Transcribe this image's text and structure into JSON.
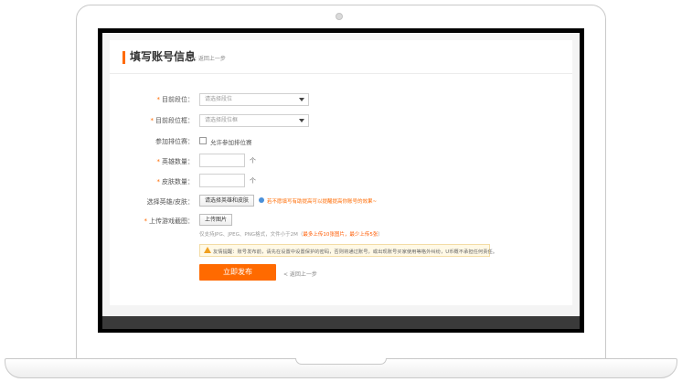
{
  "header": {
    "title": "填写账号信息",
    "back_link": "< 返回上一步"
  },
  "form": {
    "current_rank": {
      "label": "目前段位：",
      "placeholder": "请选择段位"
    },
    "current_tier": {
      "label": "目前段位框：",
      "placeholder": "请选择段位框"
    },
    "tournament": {
      "label": "参加排位赛：",
      "checkbox_label": "允许参加排位赛"
    },
    "hero_count": {
      "label": "英雄数量：",
      "unit": "个"
    },
    "skin_count": {
      "label": "皮肤数量：",
      "unit": "个"
    },
    "select_heroes": {
      "label": "选择英雄/皮肤：",
      "button": "请选择英雄和皮肤",
      "hint": "若不愿填写有助提高可以提醒提高你账号的效果~"
    },
    "screenshot": {
      "label": "上传游戏截图：",
      "button": "上传图片",
      "note_prefix": "仅支持JPG、JPEG、PNG格式，文件小于2M（",
      "note_highlight": "最多上传10张图片，最少上传5张",
      "note_suffix": "）"
    },
    "required_mark": "*"
  },
  "warning": {
    "text": "友情提醒：账号发布前，请先在设置中设置保护的密码，否则将通过账号，或出现账号买家使用等格外纠纷，U币概不承担任何责任。"
  },
  "actions": {
    "publish": "立即发布",
    "back": "< 返回上一步"
  },
  "colors": {
    "accent": "#ff6a00",
    "warning_bg": "#fff9e6"
  }
}
